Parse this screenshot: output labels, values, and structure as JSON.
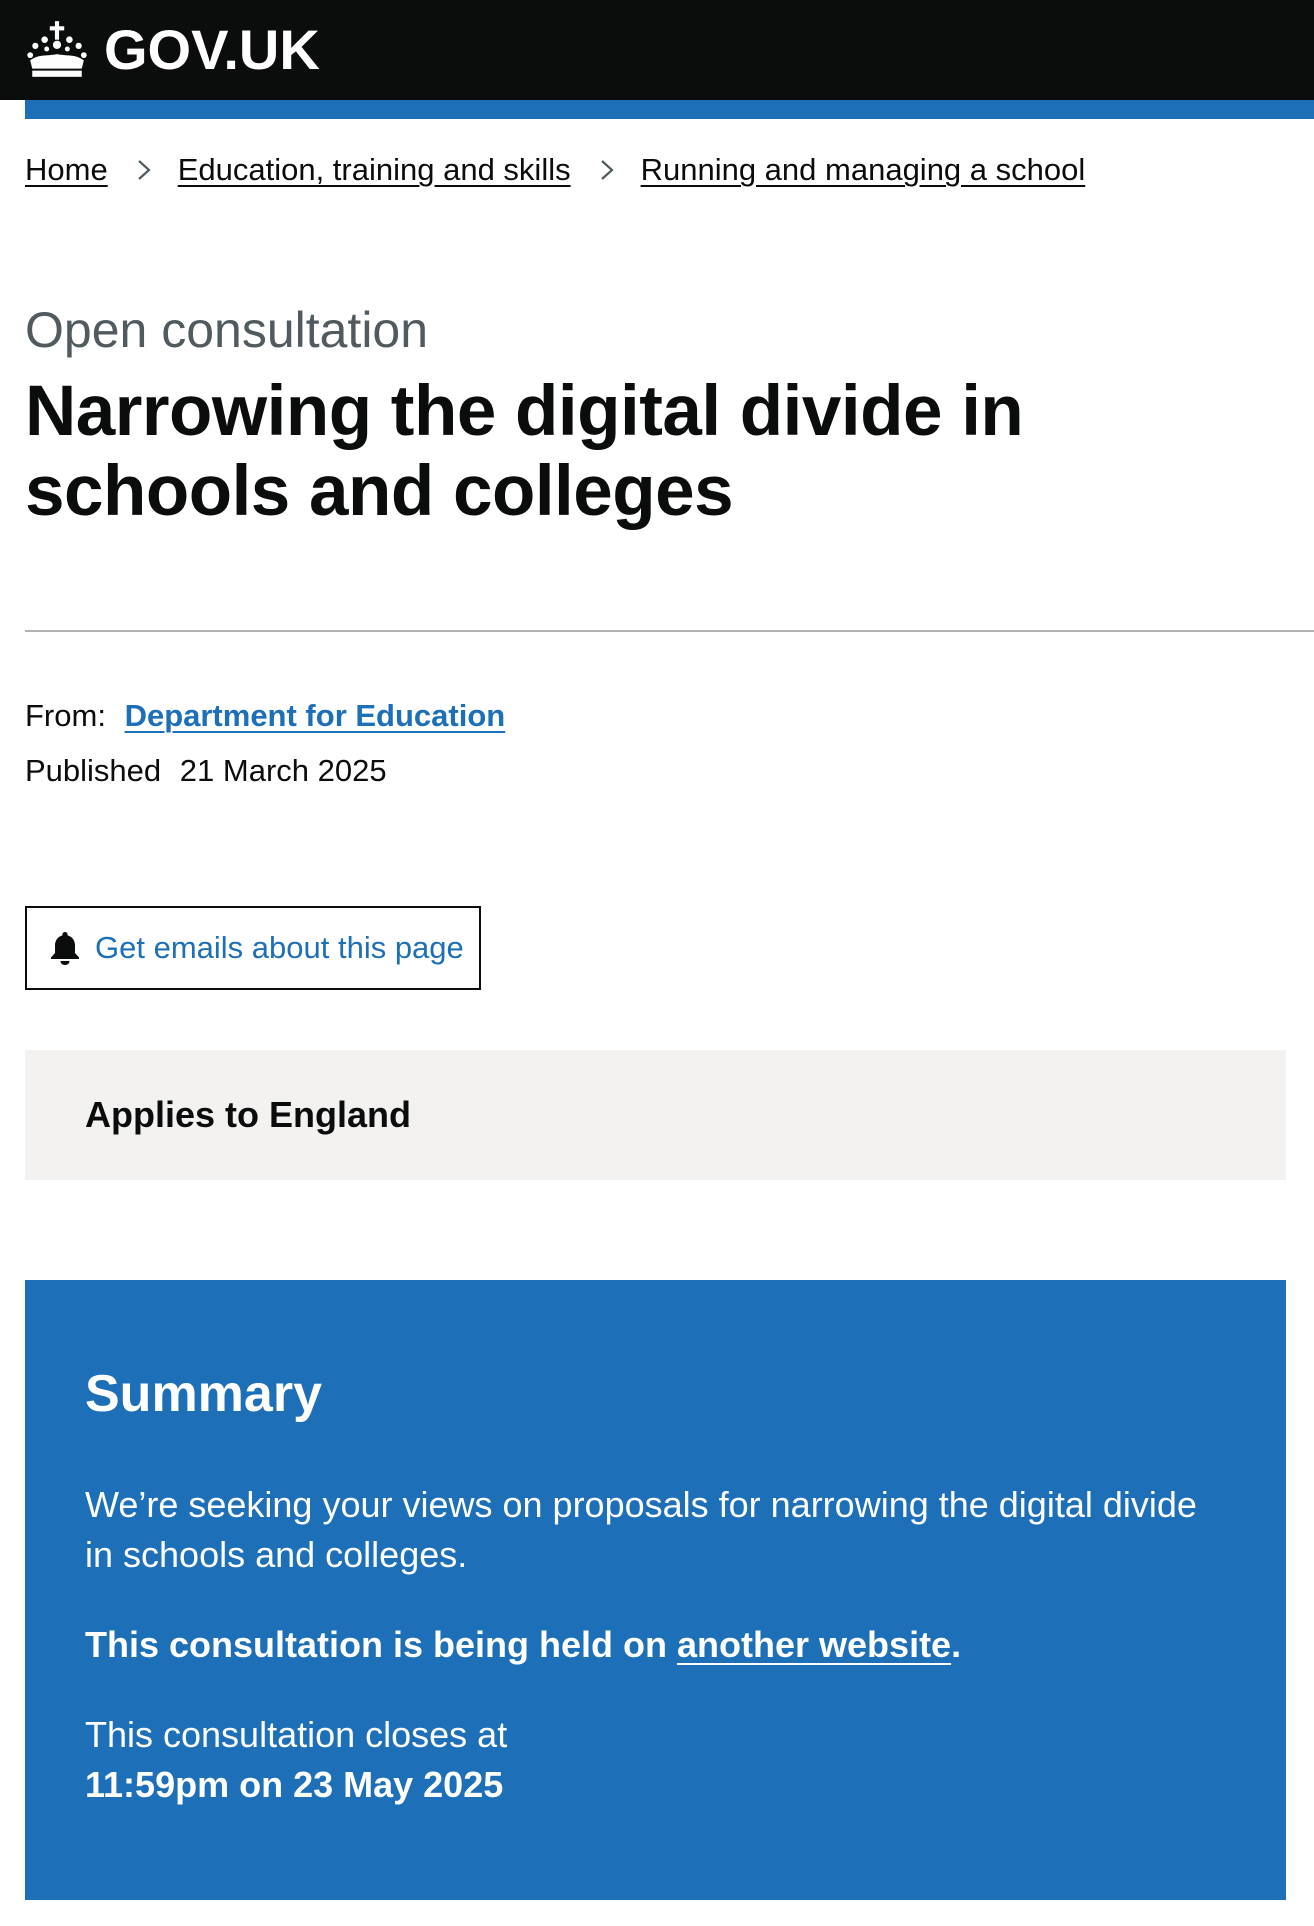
{
  "header": {
    "logo_text": "GOV.UK",
    "logo_icon": "crown-icon"
  },
  "colors": {
    "header_bg": "#0b0c0c",
    "brand_blue": "#1d70b8",
    "panel_grey": "#f3f2f1",
    "caption_grey": "#505a5f"
  },
  "breadcrumb": {
    "items": [
      {
        "label": "Home"
      },
      {
        "label": "Education, training and skills"
      },
      {
        "label": "Running and managing a school"
      }
    ],
    "separator_icon": "chevron-right-icon"
  },
  "page": {
    "caption": "Open consultation",
    "title": "Narrowing the digital divide in schools and colleges"
  },
  "metadata": {
    "from_label": "From:",
    "organisation": "Department for Education",
    "published_label": "Published",
    "published_date": "21 March 2025"
  },
  "email_signup": {
    "label": "Get emails about this page",
    "icon": "bell-icon"
  },
  "applies_to": {
    "text": "Applies to England"
  },
  "summary": {
    "heading": "Summary",
    "body": "We’re seeking your views on proposals for narrowing the digital divide in schools and colleges.",
    "notice_prefix": "This consultation is being held on ",
    "notice_link": "another website",
    "notice_suffix": ".",
    "closes_label": "This consultation closes at",
    "closes_date": "11:59pm on 23 May 2025"
  }
}
